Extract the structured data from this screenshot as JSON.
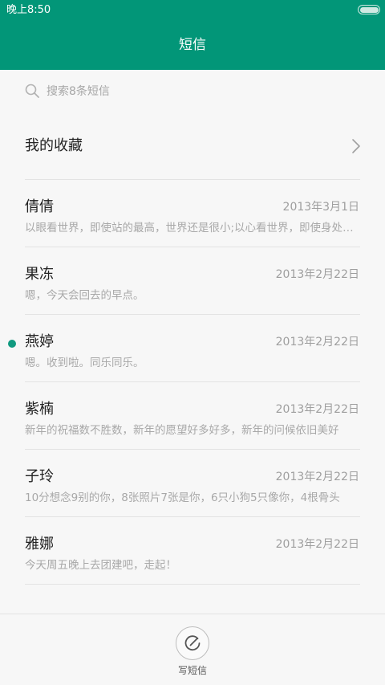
{
  "status_bar": {
    "time": "晚上8:50"
  },
  "header": {
    "title": "短信"
  },
  "search": {
    "placeholder": "搜索8条短信"
  },
  "favorites": {
    "label": "我的收藏"
  },
  "conversations": [
    {
      "name": "倩倩",
      "date": "2013年3月1日",
      "preview": "以眼看世界，即使站的最高，世界还是很小;以心看世界，即使身处最低处，世界也是很大",
      "unread": false
    },
    {
      "name": "果冻",
      "date": "2013年2月22日",
      "preview": "嗯，今天会回去的早点。",
      "unread": false
    },
    {
      "name": "燕婷",
      "date": "2013年2月22日",
      "preview": "嗯。收到啦。同乐同乐。",
      "unread": true
    },
    {
      "name": "紫楠",
      "date": "2013年2月22日",
      "preview": "新年的祝福数不胜数，新年的愿望好多好多，新年的问候依旧美好",
      "unread": false
    },
    {
      "name": "子玲",
      "date": "2013年2月22日",
      "preview": "10分想念9别的你，8张照片7张是你，6只小狗5只像你，4根骨头",
      "unread": false
    },
    {
      "name": "雅娜",
      "date": "2013年2月22日",
      "preview": "今天周五晚上去团建吧，走起！",
      "unread": false
    }
  ],
  "bottom_bar": {
    "compose_label": "写短信"
  },
  "colors": {
    "accent": "#029678",
    "unread_dot": "#119a80"
  },
  "icons": {
    "search": "search-icon",
    "chevron": "chevron-right-icon",
    "compose": "compose-icon",
    "battery": "battery-icon"
  }
}
